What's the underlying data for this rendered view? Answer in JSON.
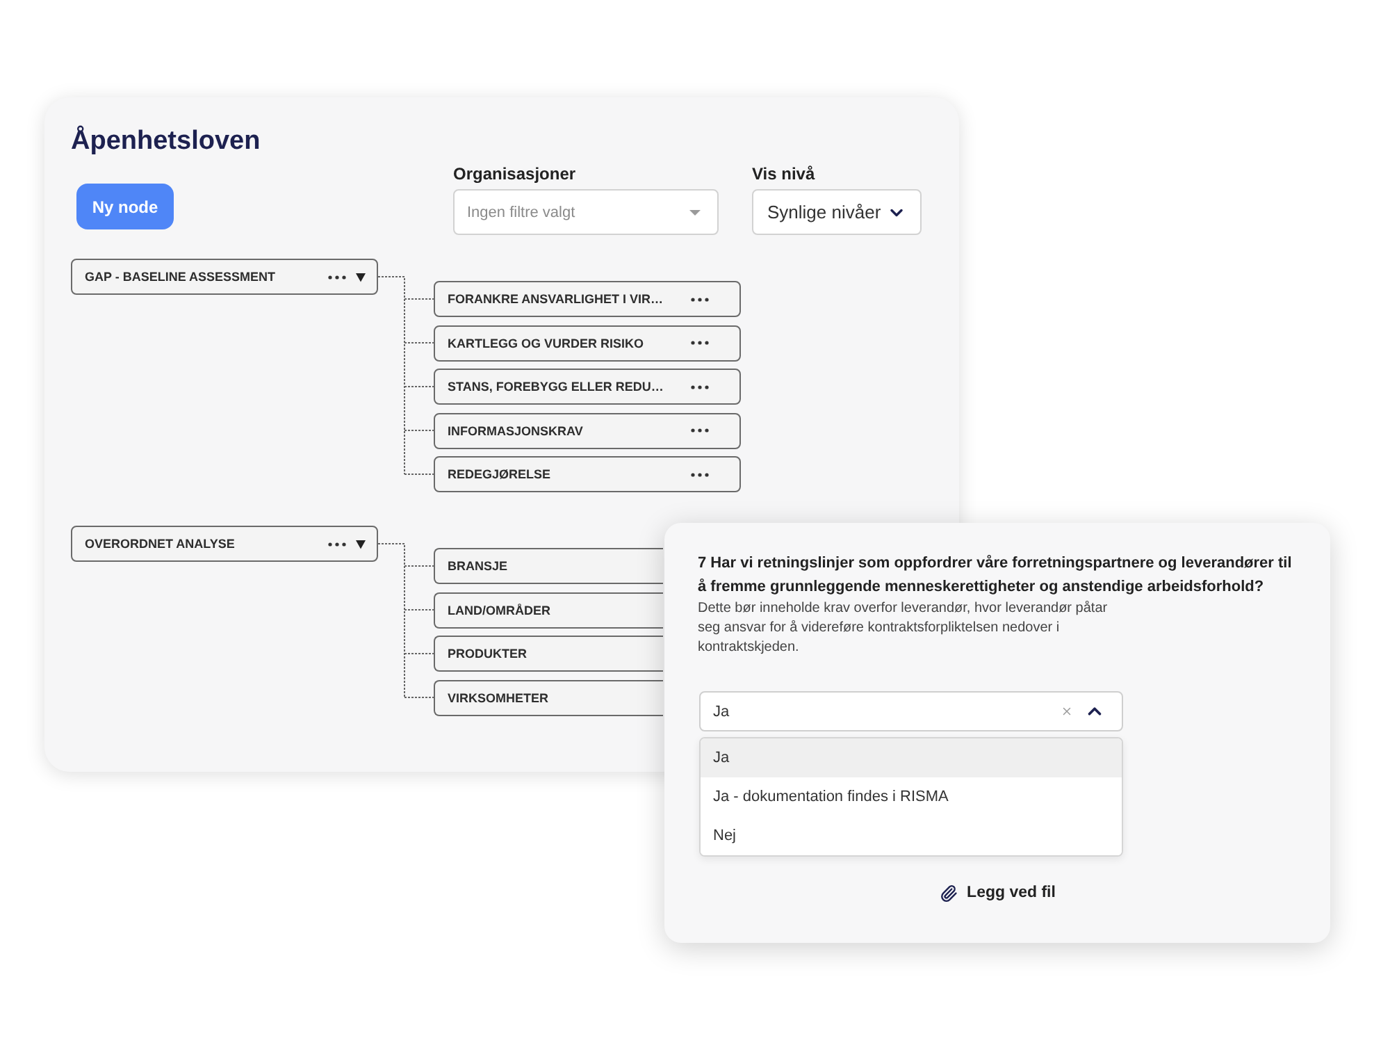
{
  "main_card": {
    "title": "Åpenhetsloven",
    "new_node_button": "Ny node",
    "filters": [
      {
        "kind": "multiselect",
        "label": "Organisasjoner",
        "placeholder": "Ingen filtre valgt"
      },
      {
        "kind": "dropdown",
        "label": "Vis nivå",
        "value": "Synlige nivåer"
      }
    ],
    "tree": [
      {
        "label": "GAP - BASELINE ASSESSMENT",
        "expanded": true,
        "children": [
          {
            "label": "FORANKRE ANSVARLIGHET I VIR…"
          },
          {
            "label": "KARTLEGG OG VURDER RISIKO"
          },
          {
            "label": "STANS, FOREBYGG ELLER REDU…"
          },
          {
            "label": "INFORMASJONSKRAV"
          },
          {
            "label": "REDEGJØRELSE"
          }
        ]
      },
      {
        "label": "OVERORDNET ANALYSE",
        "expanded": true,
        "children": [
          {
            "label": "BRANSJE"
          },
          {
            "label": "LAND/OMRÅDER"
          },
          {
            "label": "PRODUKTER"
          },
          {
            "label": "VIRKSOMHETER"
          }
        ]
      }
    ]
  },
  "question_card": {
    "question": "7 Har vi retningslinjer som oppfordrer våre forretningspartnere og leverandører til å fremme grunnleggende menneskerettigheter og anstendige arbeidsforhold?",
    "description": "Dette bør inneholde krav overfor leverandør, hvor leverandør påtar seg ansvar for å videreføre kontraktsforpliktelsen nedover i kontraktskjeden.",
    "answer_select": {
      "value": "Ja",
      "open": true,
      "options": [
        {
          "label": "Ja",
          "selected": true
        },
        {
          "label": "Ja - dokumentation findes i RISMA",
          "selected": false
        },
        {
          "label": "Nej",
          "selected": false
        }
      ]
    },
    "attach_button": "Legg ved fil"
  }
}
